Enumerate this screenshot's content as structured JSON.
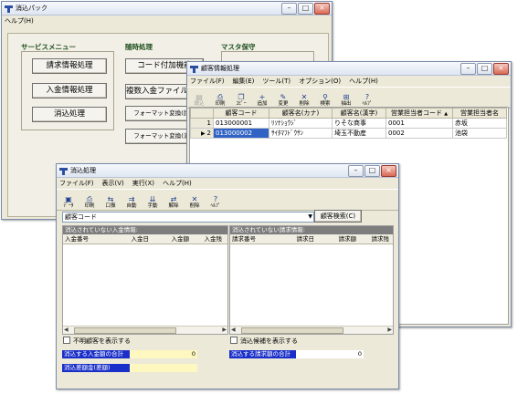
{
  "main_window": {
    "title": "消込パック",
    "menu": [
      "ヘルプ(H)"
    ],
    "sections": {
      "service": "サービスメニュー",
      "adhoc": "随時処理",
      "master": "マスタ保守"
    },
    "service_buttons": [
      "請求情報処理",
      "入金情報処理",
      "消込処理"
    ],
    "adhoc_buttons": [
      "コード付加機能",
      "複数入金ファイル結合",
      "フォーマット変換(請求",
      "フォーマット変換(消込"
    ]
  },
  "customer_window": {
    "title": "顧客情報処理",
    "menu": [
      "ファイル(F)",
      "編集(E)",
      "ツール(T)",
      "オプション(O)",
      "ヘルプ(H)"
    ],
    "toolbar": [
      {
        "label": "読込",
        "icon": "open-icon",
        "glyph": "▤",
        "disabled": true
      },
      {
        "label": "印刷",
        "icon": "print-icon",
        "glyph": "⎙",
        "disabled": false
      },
      {
        "label": "ｺﾋﾟｰ",
        "icon": "copy-icon",
        "glyph": "❐",
        "disabled": false
      },
      {
        "label": "追加",
        "icon": "add-icon",
        "glyph": "+",
        "disabled": false
      },
      {
        "label": "変更",
        "icon": "edit-icon",
        "glyph": "✎",
        "disabled": false
      },
      {
        "label": "削除",
        "icon": "delete-icon",
        "glyph": "✕",
        "disabled": false
      },
      {
        "label": "検索",
        "icon": "search-icon",
        "glyph": "⚲",
        "disabled": false
      },
      {
        "label": "抽出",
        "icon": "extract-icon",
        "glyph": "⊞",
        "disabled": false
      },
      {
        "label": "ﾍﾙﾌﾟ",
        "icon": "help-icon",
        "glyph": "?",
        "disabled": false
      }
    ],
    "columns": [
      "顧客コード",
      "顧客名(カナ)",
      "顧客名(漢字)",
      "営業担当者コード",
      "営業担当者名"
    ],
    "sort_glyph": "▲",
    "rows": [
      {
        "num": "1",
        "code": "013000001",
        "kana": "ﾘｿﾅｼｮｳｼﾞ",
        "kanji": "りそな商事",
        "rep_code": "0001",
        "rep_name": "赤坂"
      },
      {
        "num": "2",
        "code": "013000002",
        "kana": "ｻｲﾀﾏﾌﾄﾞｳｻﾝ",
        "kanji": "埼玉不動産",
        "rep_code": "0002",
        "rep_name": "池袋"
      }
    ]
  },
  "reconcile_window": {
    "title": "消込処理",
    "menu": [
      "ファイル(F)",
      "表示(V)",
      "実行(X)",
      "ヘルプ(H)"
    ],
    "toolbar": [
      {
        "label": "ﾃﾞｰﾀ",
        "icon": "save-icon",
        "glyph": "▣"
      },
      {
        "label": "印刷",
        "icon": "print-icon",
        "glyph": "⎙"
      },
      {
        "label": "口振",
        "icon": "transfer-icon",
        "glyph": "⇆"
      },
      {
        "label": "自動",
        "icon": "auto-icon",
        "glyph": "⇉"
      },
      {
        "label": "手動",
        "icon": "manual-icon",
        "glyph": "⇊"
      },
      {
        "label": "解除",
        "icon": "release-icon",
        "glyph": "⇄"
      },
      {
        "label": "削除",
        "icon": "delete-icon",
        "glyph": "✕"
      },
      {
        "label": "ﾍﾙﾌﾟ",
        "icon": "help-icon",
        "glyph": "?"
      }
    ],
    "customer_select": "顧客コード",
    "customer_search_button": "顧客検索(C)",
    "left_panel": {
      "header": "消込されていない入金情報:",
      "columns": [
        "入金番号",
        "入金日",
        "入金額",
        "入金残"
      ]
    },
    "right_panel": {
      "header": "消込されていない請求情報:",
      "columns": [
        "請求番号",
        "請求日",
        "請求額",
        "請求残"
      ]
    },
    "checkbox_unknown": "不明顧客を表示する",
    "checkbox_reconciled": "消込候補を表示する",
    "sum_deposit_label": "消込する入金額の合計",
    "sum_deposit_value": "0",
    "sum_invoice_label": "消込する請求額の合計",
    "sum_invoice_value": "0",
    "diff_label": "消込差額金(差額)"
  },
  "window_controls": {
    "min": "–",
    "max": "□",
    "close": "×"
  }
}
